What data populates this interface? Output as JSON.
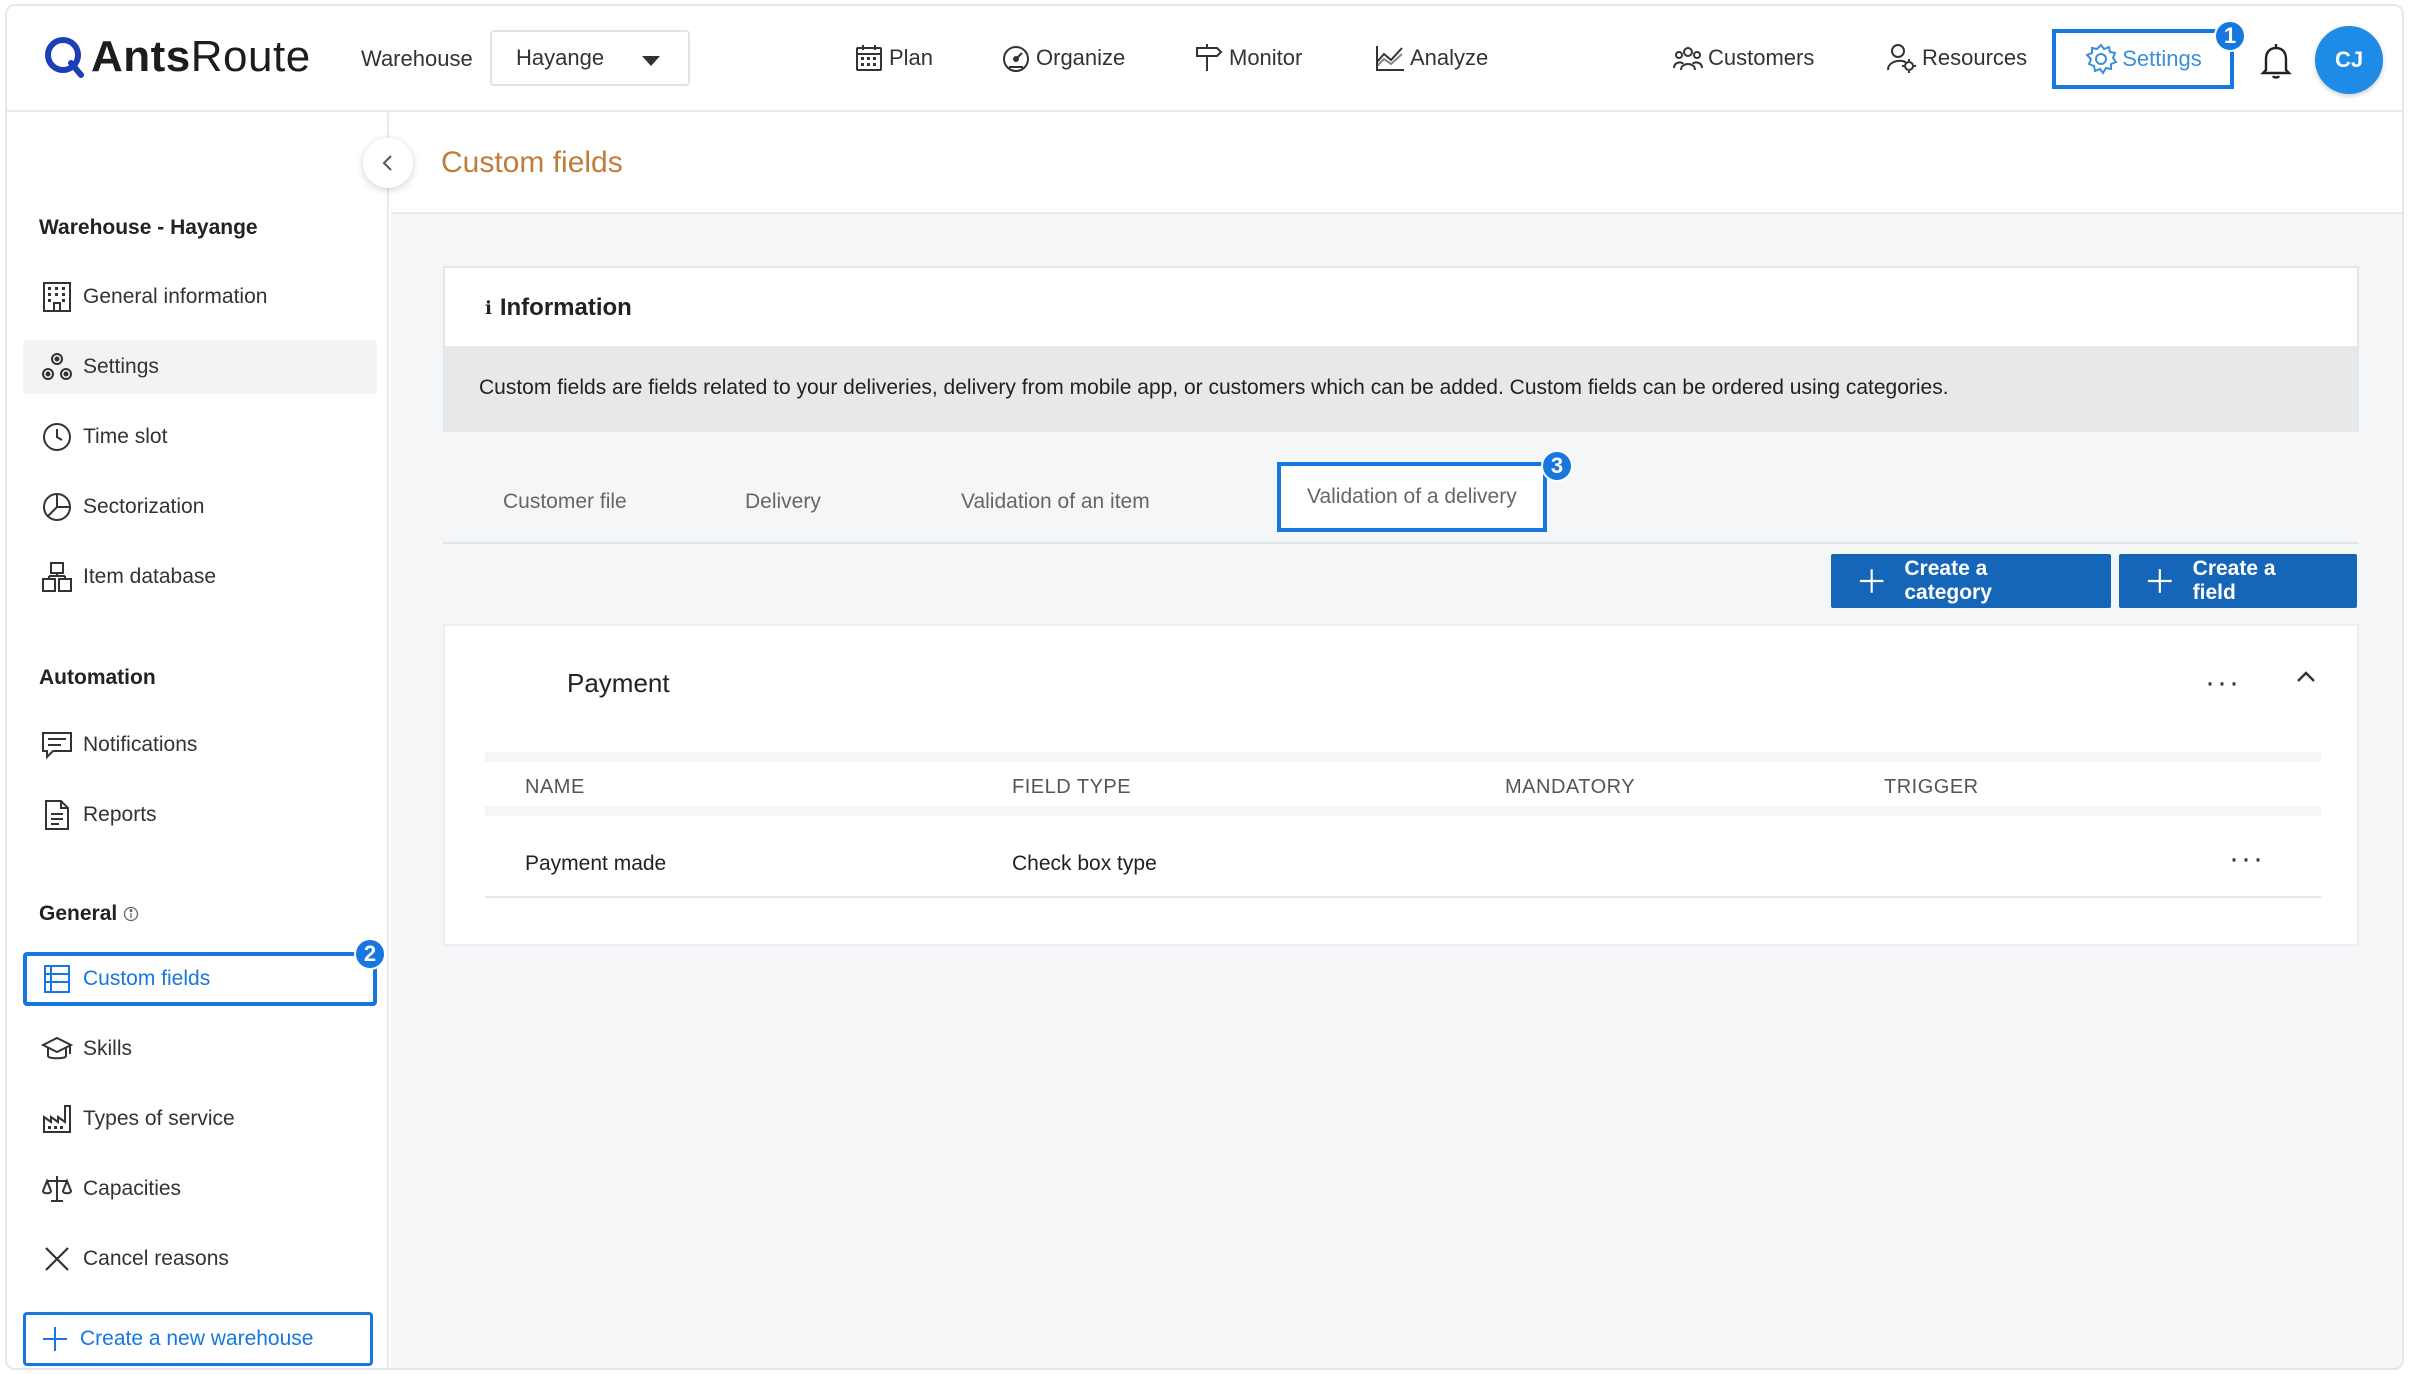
{
  "app": {
    "logo_prefix": "Ants",
    "logo_suffix": "Route"
  },
  "topbar": {
    "warehouse_label": "Warehouse",
    "warehouse_value": "Hayange",
    "nav": [
      {
        "label": "Plan",
        "icon": "calendar-icon"
      },
      {
        "label": "Organize",
        "icon": "gauge-icon"
      },
      {
        "label": "Monitor",
        "icon": "signpost-icon"
      },
      {
        "label": "Analyze",
        "icon": "chart-icon"
      },
      {
        "label": "Customers",
        "icon": "users-icon"
      },
      {
        "label": "Resources",
        "icon": "user-gear-icon"
      }
    ],
    "settings_label": "Settings",
    "settings_badge": "1",
    "avatar_initials": "CJ"
  },
  "sidebar": {
    "section_warehouse": "Warehouse - Hayange",
    "warehouse_items": [
      {
        "label": "General information",
        "icon": "building-icon"
      },
      {
        "label": "Settings",
        "icon": "settings-cluster-icon"
      },
      {
        "label": "Time slot",
        "icon": "clock-icon"
      },
      {
        "label": "Sectorization",
        "icon": "pie-icon"
      },
      {
        "label": "Item database",
        "icon": "boxes-icon"
      }
    ],
    "section_automation": "Automation",
    "automation_items": [
      {
        "label": "Notifications",
        "icon": "message-icon"
      },
      {
        "label": "Reports",
        "icon": "document-icon"
      }
    ],
    "section_general": "General",
    "general_items": [
      {
        "label": "Custom fields",
        "icon": "list-icon"
      },
      {
        "label": "Skills",
        "icon": "graduation-cap-icon"
      },
      {
        "label": "Types of service",
        "icon": "factory-icon"
      },
      {
        "label": "Capacities",
        "icon": "scale-icon"
      },
      {
        "label": "Cancel reasons",
        "icon": "x-icon"
      }
    ],
    "custom_fields_badge": "2",
    "create_warehouse": "Create a new warehouse"
  },
  "main": {
    "page_title": "Custom fields",
    "info": {
      "title": "Information",
      "body": "Custom fields are fields related to your deliveries, delivery from mobile app, or customers which can be added. Custom fields can be ordered using categories."
    },
    "tabs": [
      {
        "label": "Customer file"
      },
      {
        "label": "Delivery"
      },
      {
        "label": "Validation of an item"
      },
      {
        "label": "Validation of a delivery"
      }
    ],
    "tab_badge": "3",
    "create_category": "Create a category",
    "create_field": "Create a field",
    "category": {
      "title": "Payment",
      "columns": [
        "NAME",
        "FIELD TYPE",
        "MANDATORY",
        "TRIGGER"
      ],
      "rows": [
        {
          "name": "Payment made",
          "field_type": "Check box type",
          "mandatory": "",
          "trigger": ""
        }
      ]
    }
  },
  "colors": {
    "accent": "#1677e1",
    "button": "#1565b8",
    "title": "#c17b3a"
  }
}
